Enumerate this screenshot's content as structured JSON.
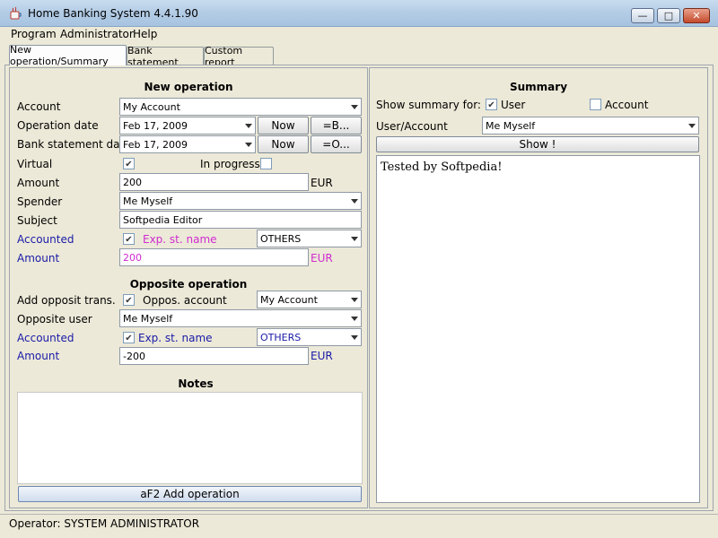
{
  "window": {
    "title": "Home Banking System 4.4.1.90"
  },
  "menu": {
    "items": [
      "Program",
      "Administrator",
      "Help"
    ]
  },
  "tabs": [
    "New operation/Summary",
    "Bank statement",
    "Custom report"
  ],
  "new_operation": {
    "heading": "New operation",
    "account_label": "Account",
    "account_value": "My Account",
    "operation_date_label": "Operation date",
    "operation_date_value": "Feb 17, 2009",
    "now_label": "Now",
    "eq_b_label": "=B...",
    "bank_statement_date_label": "Bank statement date",
    "bank_statement_date_value": "Feb 17, 2009",
    "now2_label": "Now",
    "eq_o_label": "=O...",
    "virtual_label": "Virtual",
    "virtual_checked": true,
    "in_progress_label": "In progress",
    "in_progress_checked": false,
    "amount_label": "Amount",
    "amount_value": "200",
    "currency": "EUR",
    "spender_label": "Spender",
    "spender_value": "Me Myself",
    "subject_label": "Subject",
    "subject_value": "Softpedia Editor",
    "accounted_label": "Accounted",
    "accounted_checked": true,
    "exp_st_name_label": "Exp. st. name",
    "exp_st_name_value": "OTHERS",
    "amount2_label": "Amount",
    "amount2_value": "200",
    "currency2": "EUR"
  },
  "opposite_operation": {
    "heading": "Opposite operation",
    "add_opposit_label": "Add opposit trans.",
    "add_opposit_checked": true,
    "oppos_account_label": "Oppos. account",
    "oppos_account_value": "My Account",
    "opposite_user_label": "Opposite user",
    "opposite_user_value": "Me Myself",
    "accounted_label": "Accounted",
    "accounted_checked": true,
    "exp_st_name_label": "Exp. st. name",
    "exp_st_name_value": "OTHERS",
    "amount_label": "Amount",
    "amount_value": "-200",
    "currency": "EUR"
  },
  "notes": {
    "heading": "Notes",
    "value": ""
  },
  "add_operation_label": "aF2 Add operation",
  "summary": {
    "heading": "Summary",
    "show_summary_for_label": "Show summary for:",
    "user_label": "User",
    "user_checked": true,
    "account_label": "Account",
    "account_checked": false,
    "user_account_label": "User/Account",
    "user_account_value": "Me Myself",
    "show_button_label": "Show !",
    "text": "Tested by Softpedia!"
  },
  "status": {
    "text": "Operator: SYSTEM ADMINISTRATOR"
  },
  "colors": {
    "accent_blue": "#1a1aa8",
    "accent_magenta": "#d12ad1"
  }
}
